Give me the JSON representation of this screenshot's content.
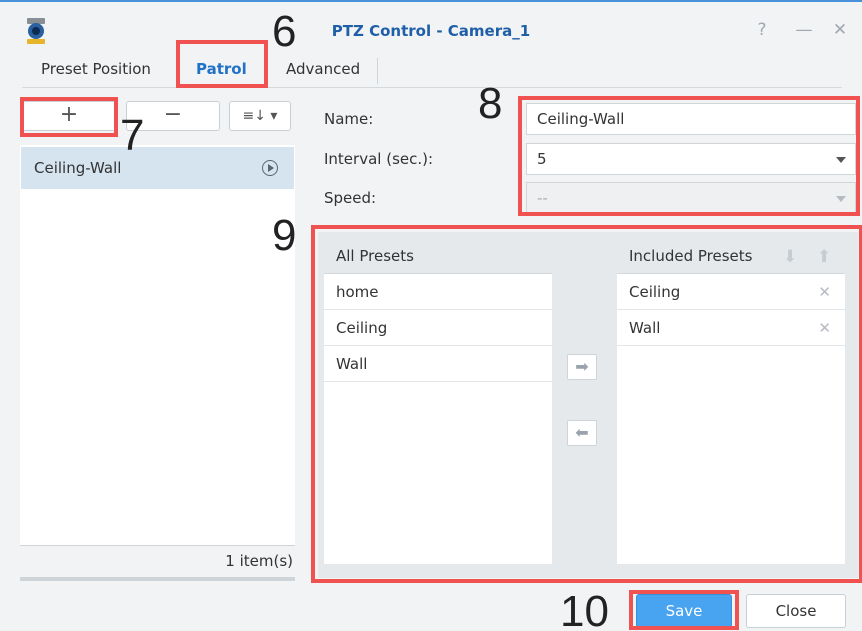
{
  "window": {
    "title": "PTZ Control - Camera_1",
    "help_icon": "help-icon",
    "minimize_icon": "minimize-icon",
    "close_icon": "close-icon"
  },
  "tabs": [
    {
      "label": "Preset Position",
      "active": false
    },
    {
      "label": "Patrol",
      "active": true
    },
    {
      "label": "Advanced",
      "active": false
    }
  ],
  "toolbar": {
    "add_label": "+",
    "remove_label": "−",
    "sort_label": "≡↓ ▾"
  },
  "patrol_list": {
    "items": [
      {
        "label": "Ceiling-Wall",
        "selected": true
      }
    ],
    "count_text": "1 item(s)"
  },
  "form": {
    "name_label": "Name:",
    "name_value": "Ceiling-Wall",
    "interval_label": "Interval (sec.):",
    "interval_value": "5",
    "speed_label": "Speed:",
    "speed_value": "--"
  },
  "presets": {
    "all_header": "All Presets",
    "all_items": [
      "home",
      "Ceiling",
      "Wall"
    ],
    "included_header": "Included Presets",
    "included_items": [
      "Ceiling",
      "Wall"
    ],
    "add_arrow": "➡",
    "remove_arrow": "⬅"
  },
  "footer": {
    "save_label": "Save",
    "close_label": "Close"
  },
  "callouts": [
    "6",
    "7",
    "8",
    "9",
    "10"
  ],
  "colors": {
    "accent": "#1f72c7",
    "save_button": "#48a3f0",
    "highlight_box": "#f05252",
    "selected_row": "#d5e4ef"
  }
}
